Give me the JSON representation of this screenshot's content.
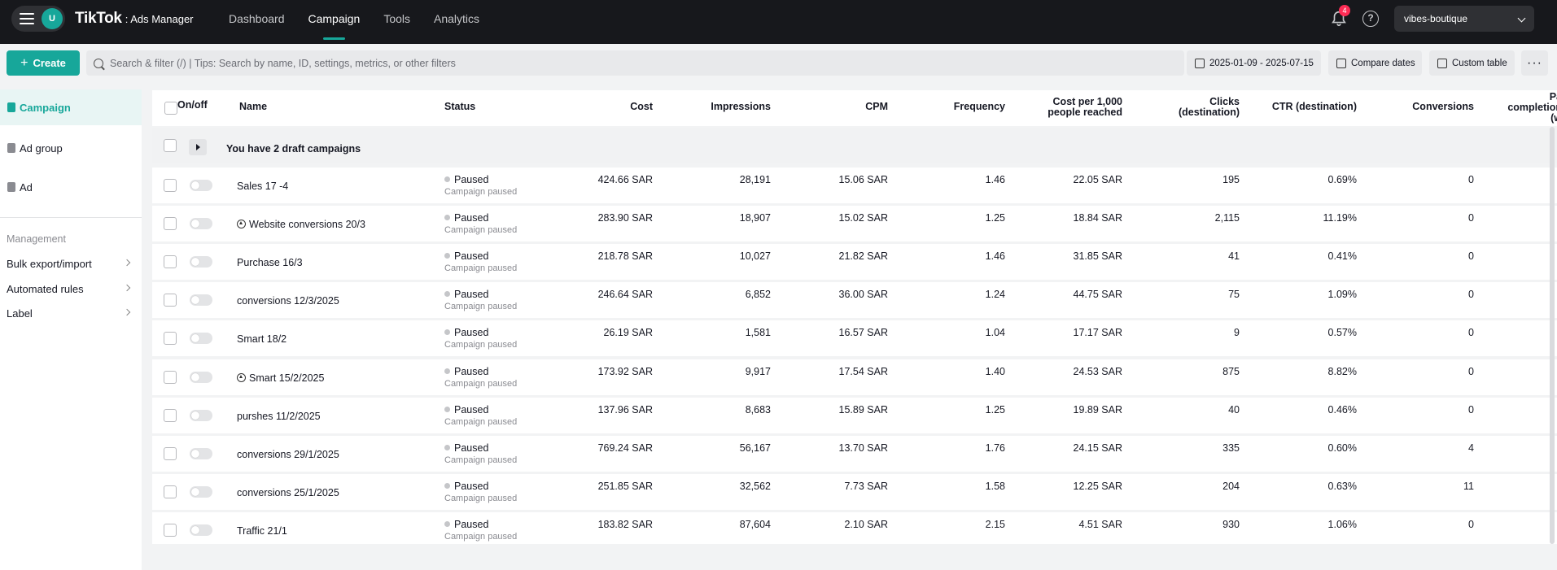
{
  "nav": {
    "account_initial": "U",
    "logo_main": "TikTok",
    "logo_sub": ": Ads Manager",
    "links": [
      "Dashboard",
      "Campaign",
      "Tools",
      "Analytics"
    ],
    "active_link": "Campaign",
    "notifications_count": "4",
    "help_glyph": "?",
    "account_name": "vibes-boutique"
  },
  "toolbar": {
    "create_label": "Create",
    "search_placeholder": "Search & filter (/) | Tips: Search by name, ID, settings, metrics, or other filters",
    "date_range": "2025-01-09 - 2025-07-15",
    "compare_label": "Compare dates",
    "custom_table_label": "Custom table",
    "more_label": "···"
  },
  "sidebar": {
    "levels": [
      "Campaign",
      "Ad group",
      "Ad"
    ],
    "management_heading": "Management",
    "links": [
      "Bulk export/import",
      "Automated rules",
      "Label"
    ]
  },
  "table": {
    "headers": {
      "onoff": "On/off",
      "name": "Name",
      "status": "Status",
      "cost": "Cost",
      "impressions": "Impressions",
      "cpm": "CPM",
      "frequency": "Frequency",
      "cost_per_1000_line1": "Cost per 1,000",
      "cost_per_1000_line2": "people reached",
      "clicks_line1": "Clicks",
      "clicks_line2": "(destination)",
      "ctr": "CTR (destination)",
      "conversions": "Conversions",
      "extra_line1": "Pa",
      "extra_line2": "completion",
      "extra_line3": "(w"
    },
    "draft_text": "You have 2 draft campaigns",
    "status_sub": "Campaign paused",
    "rows": [
      {
        "name": "Sales 17 -4",
        "automated": false,
        "status": "Paused",
        "cost": "424.66 SAR",
        "impressions": "28,191",
        "cpm": "15.06 SAR",
        "frequency": "1.46",
        "cost_per_1000": "22.05 SAR",
        "clicks": "195",
        "ctr": "0.69%",
        "conversions": "0"
      },
      {
        "name": "Website conversions 20/3",
        "automated": true,
        "status": "Paused",
        "cost": "283.90 SAR",
        "impressions": "18,907",
        "cpm": "15.02 SAR",
        "frequency": "1.25",
        "cost_per_1000": "18.84 SAR",
        "clicks": "2,115",
        "ctr": "11.19%",
        "conversions": "0"
      },
      {
        "name": "Purchase 16/3",
        "automated": false,
        "status": "Paused",
        "cost": "218.78 SAR",
        "impressions": "10,027",
        "cpm": "21.82 SAR",
        "frequency": "1.46",
        "cost_per_1000": "31.85 SAR",
        "clicks": "41",
        "ctr": "0.41%",
        "conversions": "0"
      },
      {
        "name": "conversions 12/3/2025",
        "automated": false,
        "status": "Paused",
        "cost": "246.64 SAR",
        "impressions": "6,852",
        "cpm": "36.00 SAR",
        "frequency": "1.24",
        "cost_per_1000": "44.75 SAR",
        "clicks": "75",
        "ctr": "1.09%",
        "conversions": "0"
      },
      {
        "name": "Smart 18/2",
        "automated": false,
        "status": "Paused",
        "cost": "26.19 SAR",
        "impressions": "1,581",
        "cpm": "16.57 SAR",
        "frequency": "1.04",
        "cost_per_1000": "17.17 SAR",
        "clicks": "9",
        "ctr": "0.57%",
        "conversions": "0"
      },
      {
        "name": "Smart 15/2/2025",
        "automated": true,
        "status": "Paused",
        "cost": "173.92 SAR",
        "impressions": "9,917",
        "cpm": "17.54 SAR",
        "frequency": "1.40",
        "cost_per_1000": "24.53 SAR",
        "clicks": "875",
        "ctr": "8.82%",
        "conversions": "0"
      },
      {
        "name": "purshes 11/2/2025",
        "automated": false,
        "status": "Paused",
        "cost": "137.96 SAR",
        "impressions": "8,683",
        "cpm": "15.89 SAR",
        "frequency": "1.25",
        "cost_per_1000": "19.89 SAR",
        "clicks": "40",
        "ctr": "0.46%",
        "conversions": "0"
      },
      {
        "name": "conversions 29/1/2025",
        "automated": false,
        "status": "Paused",
        "cost": "769.24 SAR",
        "impressions": "56,167",
        "cpm": "13.70 SAR",
        "frequency": "1.76",
        "cost_per_1000": "24.15 SAR",
        "clicks": "335",
        "ctr": "0.60%",
        "conversions": "4"
      },
      {
        "name": "conversions 25/1/2025",
        "automated": false,
        "status": "Paused",
        "cost": "251.85 SAR",
        "impressions": "32,562",
        "cpm": "7.73 SAR",
        "frequency": "1.58",
        "cost_per_1000": "12.25 SAR",
        "clicks": "204",
        "ctr": "0.63%",
        "conversions": "11"
      },
      {
        "name": "Traffic 21/1",
        "automated": false,
        "status": "Paused",
        "cost": "183.82 SAR",
        "impressions": "87,604",
        "cpm": "2.10 SAR",
        "frequency": "2.15",
        "cost_per_1000": "4.51 SAR",
        "clicks": "930",
        "ctr": "1.06%",
        "conversions": "0"
      }
    ]
  },
  "colors": {
    "accent": "#17a79a",
    "nav_bg": "#17181c",
    "badge": "#fe2c55"
  }
}
